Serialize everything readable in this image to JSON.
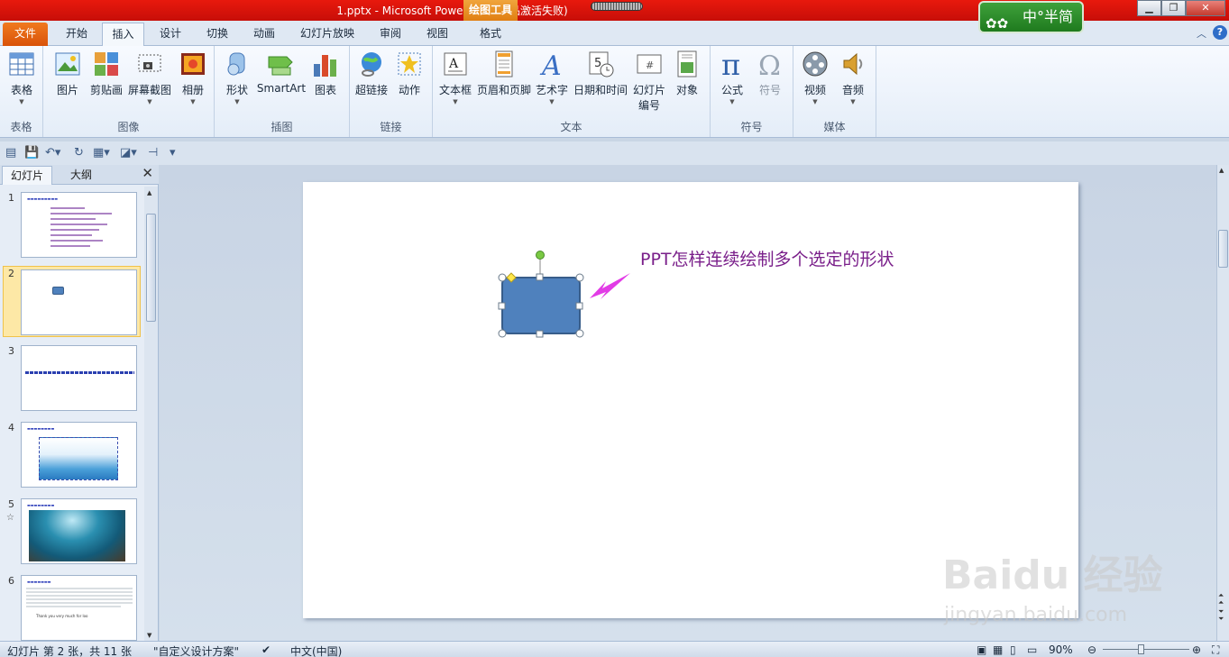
{
  "titlebar": {
    "title": "1.pptx - Microsoft PowerPoint(产品激活失败)",
    "context_tab": "绘图工具",
    "ime_text": "中°半简"
  },
  "tabs": [
    "文件",
    "开始",
    "插入",
    "设计",
    "切换",
    "动画",
    "幻灯片放映",
    "审阅",
    "视图",
    "格式"
  ],
  "active_tab": "插入",
  "ribbon": {
    "groups": [
      {
        "label": "表格",
        "buttons": [
          "表格"
        ]
      },
      {
        "label": "图像",
        "buttons": [
          "图片",
          "剪贴画",
          "屏幕截图",
          "相册"
        ]
      },
      {
        "label": "插图",
        "buttons": [
          "形状",
          "SmartArt",
          "图表"
        ]
      },
      {
        "label": "链接",
        "buttons": [
          "超链接",
          "动作"
        ]
      },
      {
        "label": "文本",
        "buttons": [
          "文本框",
          "页眉和页脚",
          "艺术字",
          "日期和时间",
          "幻灯片编号",
          "对象"
        ]
      },
      {
        "label": "符号",
        "buttons": [
          "公式",
          "符号"
        ]
      },
      {
        "label": "媒体",
        "buttons": [
          "视频",
          "音频"
        ]
      }
    ],
    "slide_number_line1": "幻灯片",
    "slide_number_line2": "编号"
  },
  "left_pane": {
    "tab_slides": "幻灯片",
    "tab_outline": "大纲",
    "slides": [
      {
        "number": "1"
      },
      {
        "number": "2"
      },
      {
        "number": "3"
      },
      {
        "number": "4"
      },
      {
        "number": "5"
      },
      {
        "number": "6"
      }
    ],
    "thumb6_text": "Thank you very much for loo"
  },
  "slide": {
    "text": "PPT怎样连续绘制多个选定的形状",
    "shape_color": "#4f81bd",
    "arrow_color": "#e23be6"
  },
  "watermark": {
    "brand": "Baidu 经验",
    "url": "jingyan.baidu.com"
  },
  "status": {
    "slide_info": "幻灯片 第 2 张，共 11 张",
    "theme": "\"自定义设计方案\"",
    "language": "中文(中国)",
    "zoom": "90%"
  }
}
